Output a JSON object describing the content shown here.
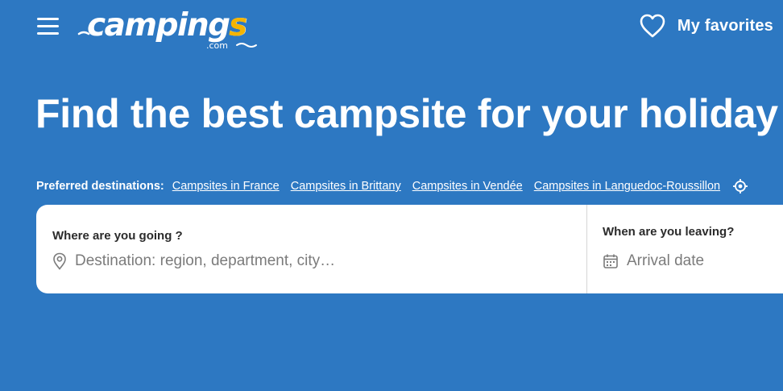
{
  "header": {
    "logo_main": "campings",
    "logo_sub": ".com",
    "favorites_label": "My favorites",
    "icons": {
      "menu": "hamburger-menu-icon",
      "favorites": "heart-outline-icon"
    }
  },
  "hero": {
    "title": "Find the best campsite for your holiday"
  },
  "preferred": {
    "label": "Preferred destinations:",
    "links": [
      "Campsites in France",
      "Campsites in Brittany",
      "Campsites in Vendée",
      "Campsites in Languedoc-Roussillon"
    ]
  },
  "search": {
    "destination": {
      "title": "Where are you going ?",
      "placeholder": "Destination: region, department, city…"
    },
    "date": {
      "title": "When are you leaving?",
      "placeholder": "Arrival date"
    }
  },
  "colors": {
    "background": "#2d78c2",
    "logo_accent": "#f5b400",
    "card": "#ffffff"
  }
}
